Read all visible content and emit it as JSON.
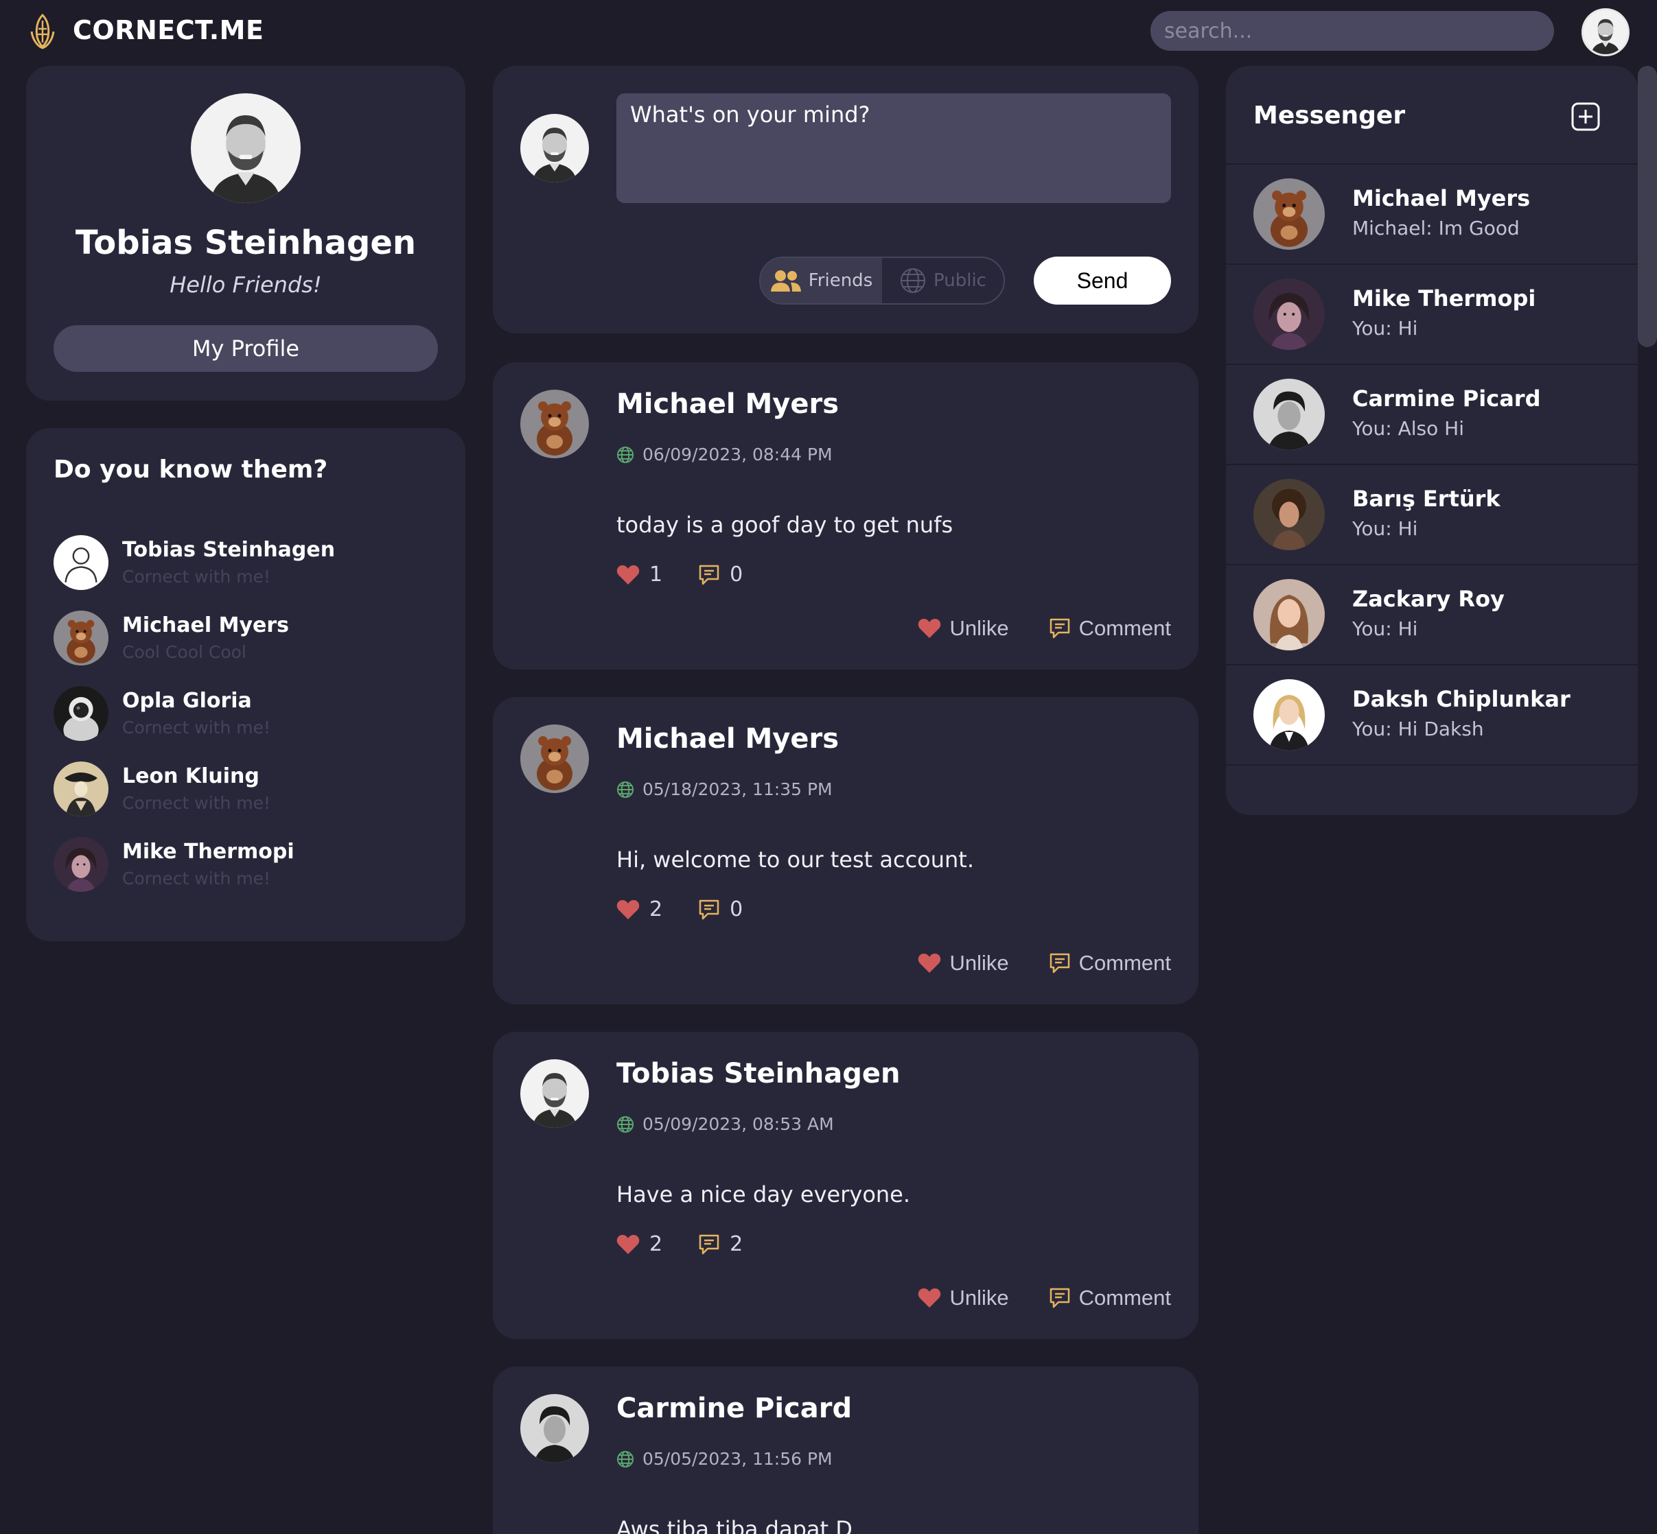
{
  "app": {
    "name": "CORNECT.ME"
  },
  "header": {
    "search_placeholder": "search..."
  },
  "profile": {
    "name": "Tobias Steinhagen",
    "status": "Hello Friends!",
    "button_label": "My Profile"
  },
  "suggestions": {
    "title": "Do you know them?",
    "items": [
      {
        "name": "Tobias Steinhagen",
        "subtitle": "Cornect with me!",
        "avatar": "default-user-icon"
      },
      {
        "name": "Michael Myers",
        "subtitle": "Cool Cool Cool",
        "avatar": "bear"
      },
      {
        "name": "Opla Gloria",
        "subtitle": "Cornect with me!",
        "avatar": "astronaut"
      },
      {
        "name": "Leon Kluing",
        "subtitle": "Cornect with me!",
        "avatar": "painting"
      },
      {
        "name": "Mike Thermopi",
        "subtitle": "Cornect with me!",
        "avatar": "person"
      }
    ]
  },
  "composer": {
    "placeholder": "What's on your mind?",
    "visibility_options": [
      "Friends",
      "Public"
    ],
    "selected_visibility": "Friends",
    "send_label": "Send"
  },
  "posts": [
    {
      "author": "Michael Myers",
      "date": "06/09/2023, 08:44 PM",
      "content": "today is a goof day to get nufs",
      "likes": "1",
      "comments": "0",
      "like_label": "Unlike",
      "comment_label": "Comment"
    },
    {
      "author": "Michael Myers",
      "date": "05/18/2023, 11:35 PM",
      "content": "Hi, welcome to our test account.",
      "likes": "2",
      "comments": "0",
      "like_label": "Unlike",
      "comment_label": "Comment"
    },
    {
      "author": "Tobias Steinhagen",
      "date": "05/09/2023, 08:53 AM",
      "content": "Have a nice day everyone.",
      "likes": "2",
      "comments": "2",
      "like_label": "Unlike",
      "comment_label": "Comment"
    },
    {
      "author": "Carmine Picard",
      "date": "05/05/2023, 11:56 PM",
      "content": "Aws tiba tiba dapat D"
    }
  ],
  "messenger": {
    "title": "Messenger",
    "conversations": [
      {
        "name": "Michael Myers",
        "last_message": "Michael: Im Good"
      },
      {
        "name": "Mike Thermopi",
        "last_message": "You: Hi"
      },
      {
        "name": "Carmine Picard",
        "last_message": "You: Also Hi"
      },
      {
        "name": "Barış Ertürk",
        "last_message": "You: Hi"
      },
      {
        "name": "Zackary Roy",
        "last_message": "You: Hi"
      },
      {
        "name": "Daksh Chiplunkar",
        "last_message": "You: Hi Daksh"
      }
    ]
  },
  "colors": {
    "background": "#1d1c28",
    "card": "#28273a",
    "input": "#4a4760",
    "accent": "#e5b45e",
    "heart": "#d05a5a",
    "globe": "#5aa86e"
  }
}
